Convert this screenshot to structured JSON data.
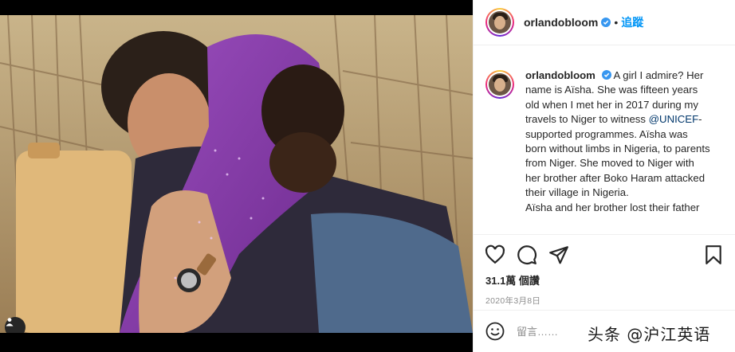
{
  "post": {
    "photo_alt": "Photo",
    "tag_icon": "user-tag-icon"
  },
  "header": {
    "username": "orlandobloom",
    "separator": "•",
    "follow_label": "追蹤"
  },
  "caption": {
    "username": "orlandobloom",
    "text_before_mention": "A girl I admire? Her name is Aïsha. She was fifteen years old when I met her in 2017 during my travels to Niger to witness ",
    "mention": "@UNICEF",
    "text_after_mention": "-supported programmes. Aïsha was born without limbs in Nigeria, to parents from Niger. She moved to Niger with her brother after Boko Haram attacked their village in Nigeria.",
    "text_second_paragraph": "Aïsha and her brother lost their father"
  },
  "actions": {
    "like_icon": "heart-icon",
    "comment_icon": "comment-icon",
    "share_icon": "paper-plane-icon",
    "save_icon": "bookmark-icon"
  },
  "stats": {
    "likes": "31.1萬 個讚",
    "date": "2020年3月8日"
  },
  "comment": {
    "placeholder": "留言……",
    "emoji_icon": "smiley-icon"
  },
  "watermark": "头条 @沪江英语",
  "colors": {
    "accent": "#0095f6",
    "text": "#262626",
    "muted": "#8e8e8e",
    "mention": "#00376b",
    "purple_scarf": "#8a3aa8"
  }
}
